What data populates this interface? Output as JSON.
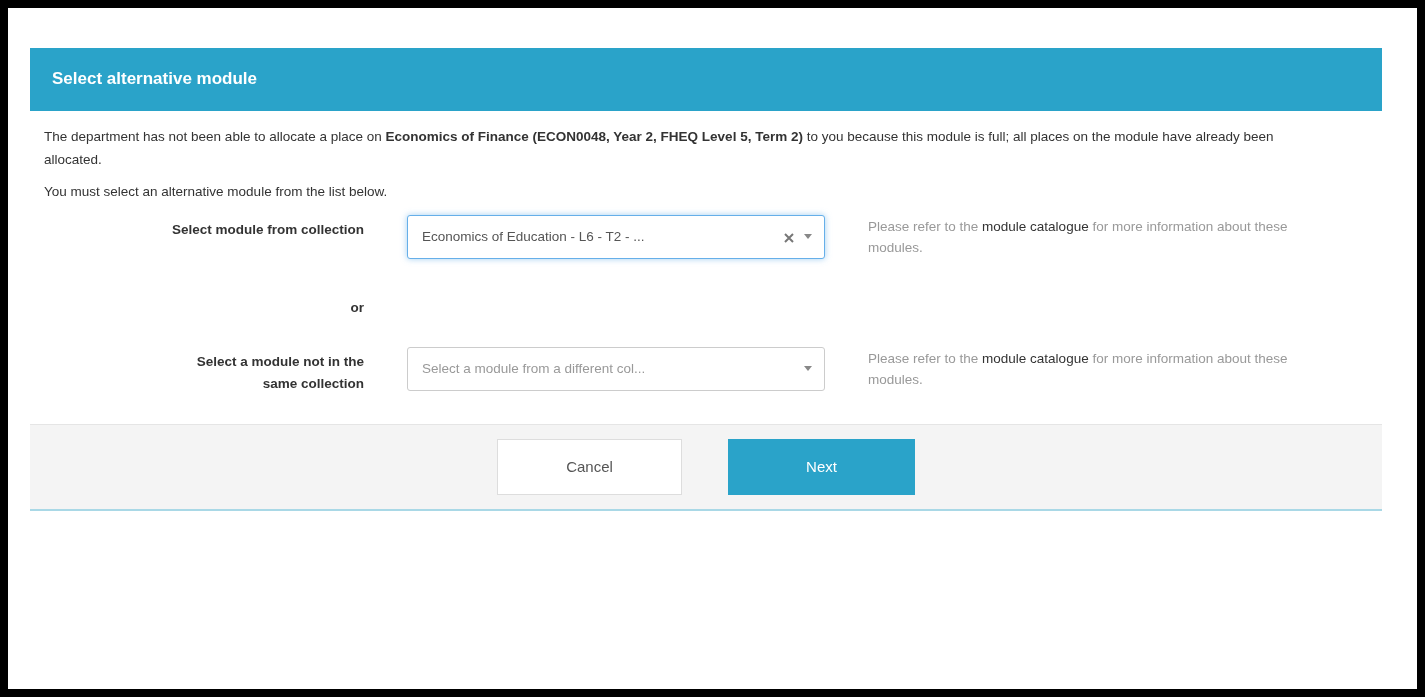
{
  "dialog": {
    "title": "Select alternative module",
    "paragraphs": [
      "The department has not been able to allocate a place on **Economics of Finance (ECON0048, Year 2, FHEQ Level 5, Term 2)** to you because this module is full; all places on the module have already been allocated.",
      "You must select an alternative module from the list below."
    ],
    "fields": [
      {
        "kind": "select",
        "label": "Select module from collection",
        "value": "Economics of Education - L6 - T2 - ...",
        "clearable": true,
        "focused": true,
        "help": {
          "before": "Please refer to the",
          "link": "module catalogue",
          "after": "for more information about these modules."
        }
      },
      {
        "kind": "separator",
        "label": "or"
      },
      {
        "kind": "select",
        "label": "Select a module not in the same collection",
        "placeholder": "Select a module from a different col...",
        "clearable": false,
        "focused": false,
        "help": {
          "before": "Please refer to the",
          "link": "module catalogue",
          "after": "for more information about these modules."
        }
      }
    ],
    "buttons": [
      {
        "label": "Cancel",
        "kind": "secondary"
      },
      {
        "label": "Next",
        "kind": "primary"
      }
    ]
  }
}
